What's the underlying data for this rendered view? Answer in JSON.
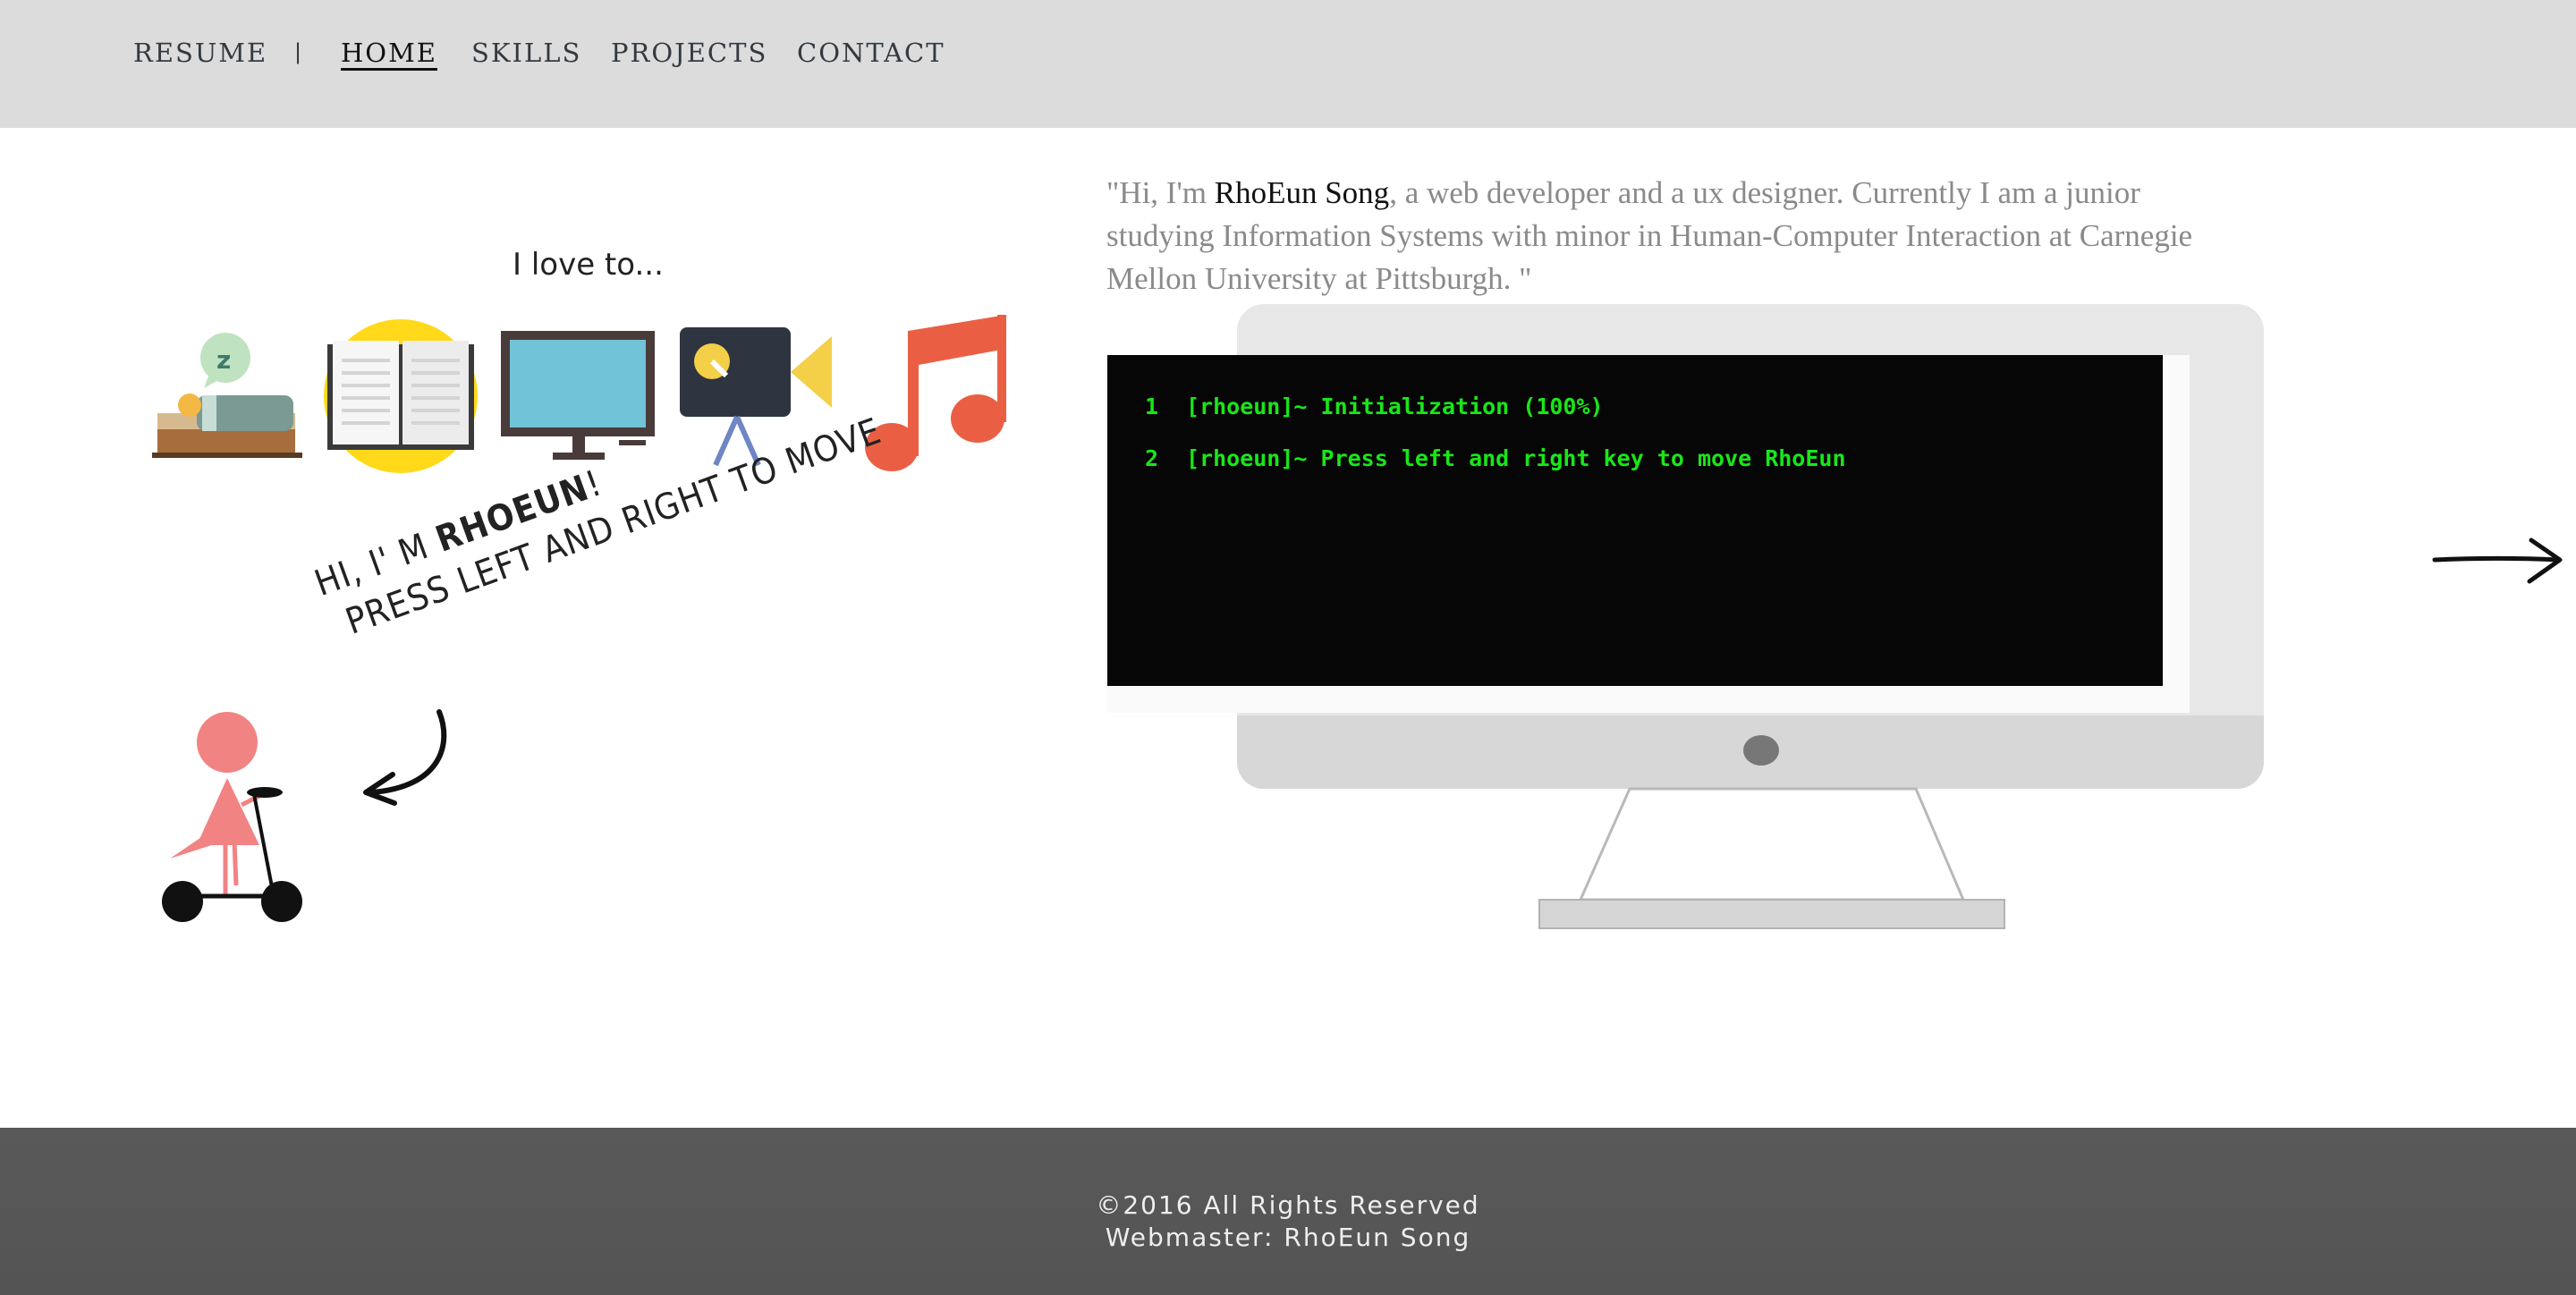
{
  "nav": {
    "resume": "RESUME",
    "separator": "|",
    "home": "HOME",
    "skills": "SKILLS",
    "projects": "PROJECTS",
    "contact": "CONTACT"
  },
  "left": {
    "love_heading": "I love to...",
    "hobby_icons": [
      "sleep-icon",
      "book-icon",
      "tv-icon",
      "video-camera-icon",
      "music-note-icon"
    ],
    "speech_line1_prefix": "Hi, I' m ",
    "speech_line1_name": "RhoEun",
    "speech_line1_suffix": "!",
    "speech_line2": "Press left and right to move"
  },
  "intro": {
    "prefix": "\"Hi, I'm ",
    "name": "RhoEun Song",
    "rest": ", a web developer and a ux designer. Currently I am a junior studying Information Systems with minor in Human-Computer Interaction at Carnegie Mellon University at Pittsburgh. \""
  },
  "terminal": {
    "lines": [
      {
        "num": "1",
        "text": "[rhoeun]~ Initialization (100%)"
      },
      {
        "num": "2",
        "text": "[rhoeun]~ Press left and right key to move RhoEun"
      }
    ]
  },
  "footer": {
    "copyright": "©2016 All Rights Reserved",
    "webmaster": "Webmaster: RhoEun Song"
  },
  "colors": {
    "nav_bg": "#dcdcdc",
    "terminal_bg": "#060606",
    "terminal_text": "#19e619",
    "footer_bg": "#575757",
    "character_pink": "#f28383"
  }
}
